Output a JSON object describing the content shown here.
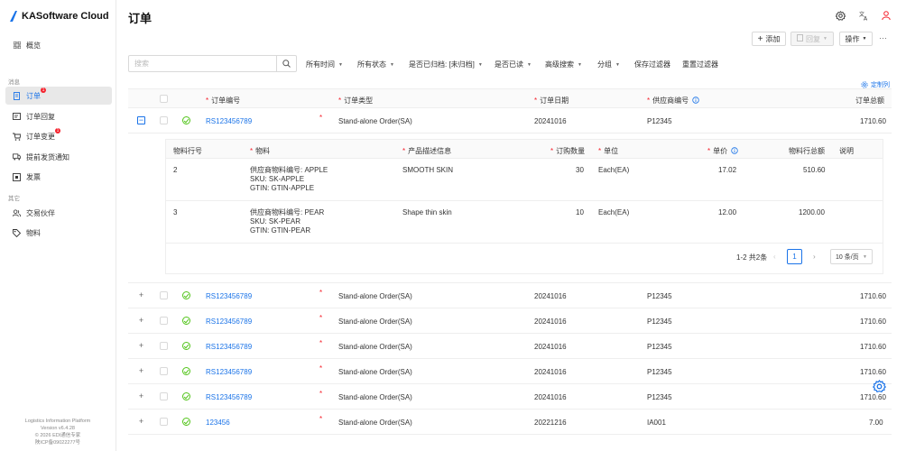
{
  "brand": {
    "name": "KASoftware Cloud"
  },
  "sidebar": {
    "overview": "概览",
    "section_messages": "消息",
    "items": [
      {
        "label": "订单",
        "badge": "1",
        "icon": "document-icon"
      },
      {
        "label": "订单回复",
        "icon": "reply-icon"
      },
      {
        "label": "订单变更",
        "badge": "1",
        "icon": "cart-icon"
      },
      {
        "label": "提前发货通知",
        "icon": "truck-icon"
      },
      {
        "label": "发票",
        "icon": "invoice-icon"
      }
    ],
    "section_other": "其它",
    "other_items": [
      {
        "label": "交易伙伴",
        "icon": "partners-icon"
      },
      {
        "label": "物料",
        "icon": "tag-icon"
      }
    ],
    "footer": [
      "Logistics Information Platform",
      "Version v6.4.28",
      "© 2026 EDI通信专家",
      "陕ICP备09022277号"
    ]
  },
  "header": {
    "title": "订单"
  },
  "toolbar": {
    "add": "添加",
    "reply": "回复",
    "actions": "操作",
    "more": "···"
  },
  "search": {
    "placeholder": "搜索"
  },
  "filters": [
    {
      "label": "所有时间",
      "caret": true
    },
    {
      "label": "所有状态",
      "caret": true
    },
    {
      "label": "是否已归档: [未归档]",
      "caret": true
    },
    {
      "label": "是否已读",
      "caret": true
    },
    {
      "label": "高级搜索",
      "caret": true
    },
    {
      "label": "分组",
      "caret": true
    },
    {
      "label": "保存过滤器",
      "caret": false
    },
    {
      "label": "重置过滤器",
      "caret": false
    }
  ],
  "customize": "定制列",
  "table": {
    "columns": [
      "订单编号",
      "订单类型",
      "订单日期",
      "供应商编号",
      "订单总额"
    ],
    "rows": [
      {
        "id": "RS123456789",
        "type": "Stand-alone Order(SA)",
        "date": "20241016",
        "supplier": "P12345",
        "total": "1710.60",
        "expanded": true
      },
      {
        "id": "RS123456789",
        "type": "Stand-alone Order(SA)",
        "date": "20241016",
        "supplier": "P12345",
        "total": "1710.60"
      },
      {
        "id": "RS123456789",
        "type": "Stand-alone Order(SA)",
        "date": "20241016",
        "supplier": "P12345",
        "total": "1710.60"
      },
      {
        "id": "RS123456789",
        "type": "Stand-alone Order(SA)",
        "date": "20241016",
        "supplier": "P12345",
        "total": "1710.60"
      },
      {
        "id": "RS123456789",
        "type": "Stand-alone Order(SA)",
        "date": "20241016",
        "supplier": "P12345",
        "total": "1710.60"
      },
      {
        "id": "RS123456789",
        "type": "Stand-alone Order(SA)",
        "date": "20241016",
        "supplier": "P12345",
        "total": "1710.60"
      },
      {
        "id": "123456",
        "type": "Stand-alone Order(SA)",
        "date": "20221216",
        "supplier": "IA001",
        "total": "7.00"
      }
    ]
  },
  "lines": {
    "columns": [
      "物料行号",
      "物料",
      "产品描述信息",
      "订购数量",
      "单位",
      "单价",
      "物料行总额",
      "说明"
    ],
    "rows": [
      {
        "line": "2",
        "item": [
          "供应商物料编号: APPLE",
          "SKU: SK-APPLE",
          "GTIN: GTIN-APPLE"
        ],
        "desc": "SMOOTH SKIN",
        "qty": "30",
        "unit": "Each(EA)",
        "price": "17.02",
        "amount": "510.60",
        "note": ""
      },
      {
        "line": "3",
        "item": [
          "供应商物料编号: PEAR",
          "SKU: SK-PEAR",
          "GTIN: GTIN-PEAR"
        ],
        "desc": "Shape thin skin",
        "qty": "10",
        "unit": "Each(EA)",
        "price": "12.00",
        "amount": "1200.00",
        "note": ""
      }
    ],
    "pagination": {
      "summary": "1-2 共2条",
      "page": "1",
      "size": "10 条/页"
    }
  },
  "colors": {
    "accent": "#1a73e8",
    "required": "#f5222d",
    "success": "#52c41a"
  }
}
